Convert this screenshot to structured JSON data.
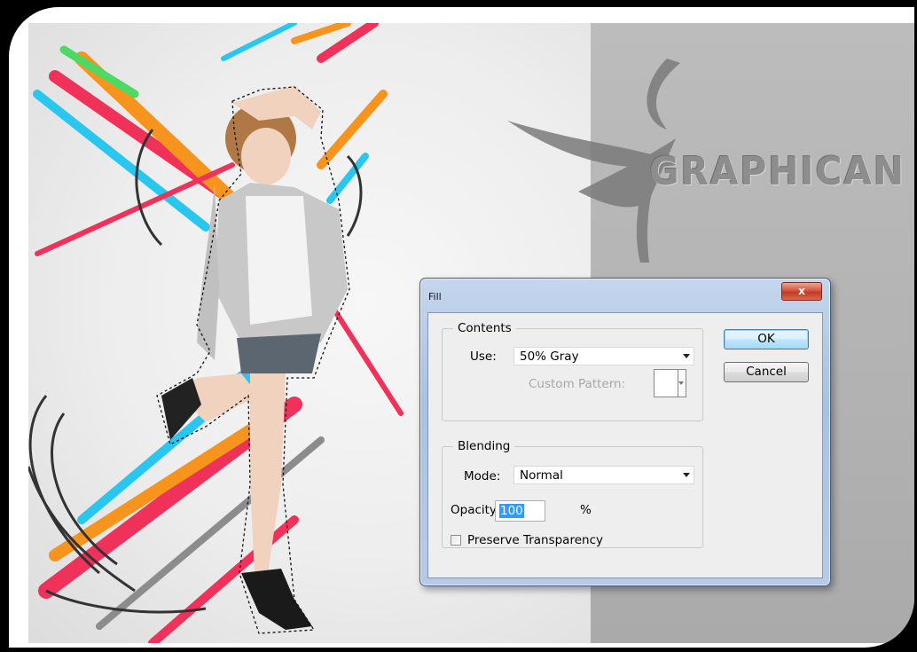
{
  "dialog": {
    "title": "Fill",
    "close_symbol": "x",
    "contents": {
      "legend": "Contents",
      "use_label": "Use:",
      "use_value": "50% Gray",
      "custom_pattern_label": "Custom Pattern:"
    },
    "blending": {
      "legend": "Blending",
      "mode_label": "Mode:",
      "mode_value": "Normal",
      "opacity_label": "Opacity:",
      "opacity_value": "100",
      "opacity_unit": "%",
      "preserve_transparency_label": "Preserve Transparency",
      "preserve_transparency_checked": false
    },
    "buttons": {
      "ok": "OK",
      "cancel": "Cancel"
    }
  },
  "canvas": {
    "brand_text": "GRAPHICAN"
  },
  "colors": {
    "stripe_red": "#f0325a",
    "stripe_orange": "#f7941d",
    "stripe_cyan": "#29c6f0",
    "stripe_gray": "#8c8c8c",
    "stripe_green": "#4cd964",
    "swirl_dark": "#333333"
  }
}
